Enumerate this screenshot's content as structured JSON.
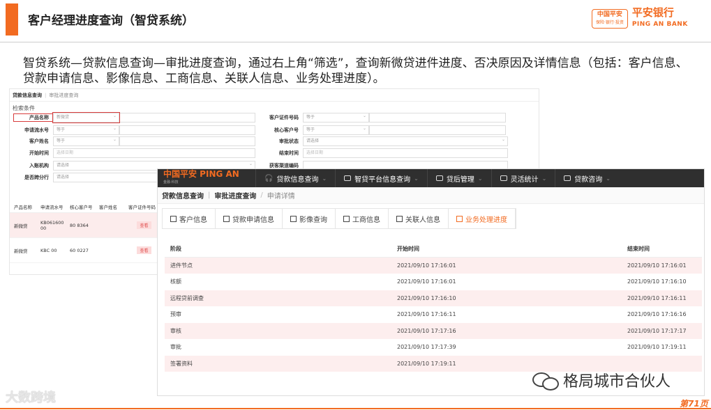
{
  "slide": {
    "title": "客户经理进度查询（智贷系统）",
    "description": "智贷系统—贷款信息查询—审批进度查询，通过右上角“筛选”，查询新微贷进件进度、否决原因及详情信息（包括：客户信息、贷款申请信息、影像信息、工商信息、关联人信息、业务处理进度）。",
    "page_number": "第71页",
    "wechat_label": "格局城市合伙人",
    "dashu_label": "大数跨境",
    "accent_color": "#f26b21"
  },
  "logo": {
    "badge_main": "中国平安",
    "badge_sub": "保险·银行·投资",
    "bank_name": "平安银行",
    "bank_en": "PING AN BANK"
  },
  "panel1": {
    "breadcrumb_main": "贷款信息查询",
    "breadcrumb_tab": "审批进度查询",
    "criteria_label": "检索条件",
    "fields": {
      "product_name": {
        "label": "产品名称",
        "value": "新微贷"
      },
      "cert_no": {
        "label": "客户证件号码",
        "value": "等于"
      },
      "apply_no": {
        "label": "申请流水号",
        "value": "等于"
      },
      "core_no": {
        "label": "核心客户号",
        "value": "等于"
      },
      "cust_name": {
        "label": "客户姓名",
        "value": "等于"
      },
      "approve_status": {
        "label": "审批状态",
        "value": "请选择"
      },
      "start_time": {
        "label": "开始时间",
        "value": "选择日期"
      },
      "end_time": {
        "label": "结束时间",
        "value": "选择日期"
      },
      "org": {
        "label": "入账机构",
        "value": "请选择"
      },
      "channel": {
        "label": "获客渠道编码",
        "value": ""
      },
      "cross_branch": {
        "label": "是否跨分行",
        "value": "请选择"
      }
    },
    "table": {
      "headers": [
        "产品名称",
        "申请流水号",
        "核心客户号",
        "客户姓名",
        "客户证件号码"
      ],
      "rows": [
        {
          "product": "新微贷",
          "apply_no": "KB061600 00",
          "core_no": "80 8364",
          "name": "",
          "action": "查看"
        },
        {
          "product": "新微贷",
          "apply_no": "KBC 00",
          "core_no": "60 0227",
          "name": "",
          "action": "查看"
        }
      ]
    }
  },
  "panel2": {
    "brand": "中国平安 PING AN",
    "brand_sub": "金融·科技",
    "nav": [
      "贷款信息查询",
      "智贷平台信息查询",
      "贷后管理",
      "灵活统计",
      "贷款咨询"
    ],
    "breadcrumb": [
      "贷款信息查询",
      "审批进度查询",
      "申请详情"
    ],
    "tabs": [
      "客户信息",
      "贷款申请信息",
      "影像查询",
      "工商信息",
      "关联人信息",
      "业务处理进度"
    ],
    "active_tab": "业务处理进度",
    "grid_headers": [
      "阶段",
      "开始时间",
      "结束时间"
    ],
    "grid_rows": [
      {
        "stage": "进件节点",
        "start": "2021/09/10 17:16:01",
        "end": "2021/09/10 17:16:01"
      },
      {
        "stage": "核额",
        "start": "2021/09/10 17:16:01",
        "end": "2021/09/10 17:16:10"
      },
      {
        "stage": "远程贷前调查",
        "start": "2021/09/10 17:16:10",
        "end": "2021/09/10 17:16:11"
      },
      {
        "stage": "预审",
        "start": "2021/09/10 17:16:11",
        "end": "2021/09/10 17:16:16"
      },
      {
        "stage": "审核",
        "start": "2021/09/10 17:17:16",
        "end": "2021/09/10 17:17:17"
      },
      {
        "stage": "审批",
        "start": "2021/09/10 17:17:39",
        "end": "2021/09/10 17:19:11"
      },
      {
        "stage": "签署资料",
        "start": "2021/09/10 17:19:11",
        "end": ""
      }
    ]
  }
}
